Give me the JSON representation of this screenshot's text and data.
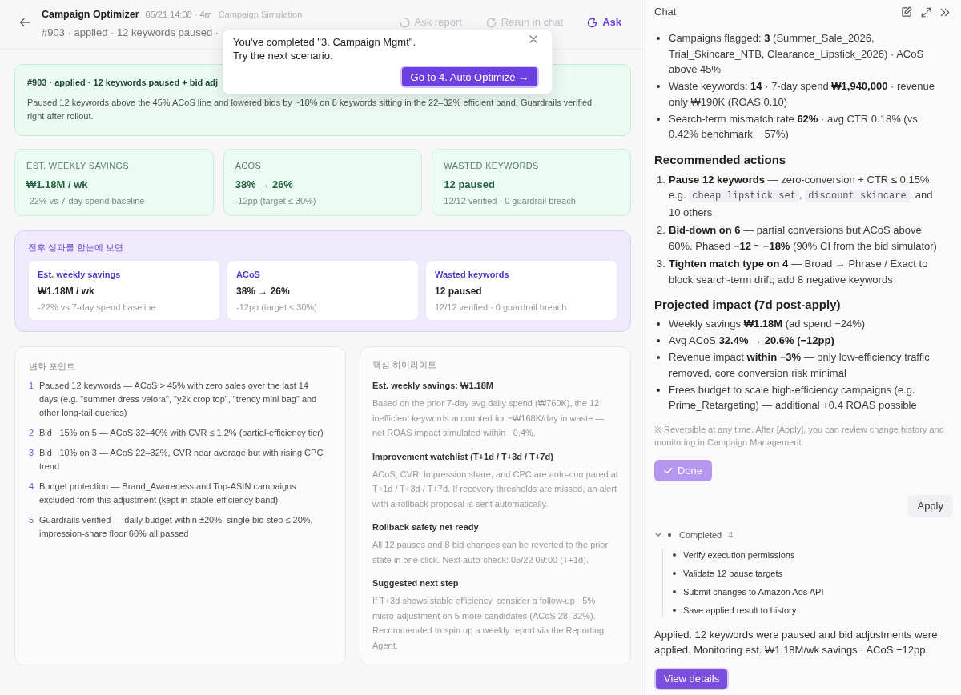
{
  "header": {
    "title": "Campaign Optimizer",
    "meta": "05/21 14:08 · 4m",
    "breadcrumb": "Campaign Simulation",
    "subtitle": "#903 · applied · 12 keywords paused ·",
    "actions": [
      {
        "kind": "spinner",
        "label": "Ask report",
        "disabled": true
      },
      {
        "kind": "refresh",
        "label": "Rerun in chat",
        "disabled": true
      },
      {
        "kind": "ask",
        "label": "Ask",
        "disabled": false
      }
    ]
  },
  "toast": {
    "message": "You've completed \"3. Campaign Mgmt\".",
    "hint": "Try the next scenario.",
    "button": "Go to 4. Auto Optimize →"
  },
  "banner": {
    "title": "#903 · applied · 12 keywords paused + bid adj",
    "body": "Paused 12 keywords above the 45% ACoS line and lowered bids by ~18% on 8 keywords sitting in the 22–32% efficient band. Guardrails verified right after rollout."
  },
  "metrics": [
    {
      "label": "EST. WEEKLY SAVINGS",
      "value": "₩1.18M / wk",
      "note": "-22% vs 7-day spend baseline"
    },
    {
      "label": "ACOS",
      "value": "38% → 26%",
      "note": "-12pp (target ≤ 30%)"
    },
    {
      "label": "WASTED KEYWORDS",
      "value": "12 paused",
      "note": "12/12 verified · 0 guardrail breach"
    }
  ],
  "comparison": {
    "title": "전후 성과를 한눈에 보면",
    "cards": [
      {
        "label": "Est. weekly savings",
        "value": "₩1.18M / wk",
        "note": "-22% vs 7-day spend baseline"
      },
      {
        "label": "ACoS",
        "value": "38% → 26%",
        "note": "-12pp (target ≤ 30%)"
      },
      {
        "label": "Wasted keywords",
        "value": "12 paused",
        "note": "12/12 verified · 0 guardrail breach"
      }
    ]
  },
  "changes": {
    "title": "변화 포인트",
    "items": [
      {
        "number": "1",
        "text": "Paused 12 keywords — ACoS > 45% with zero sales over the last 14 days (e.g. \"summer dress velora\", \"y2k crop top\", \"trendy mini bag\" and other long-tail queries)"
      },
      {
        "number": "2",
        "text": "Bid −15% on 5 — ACoS 32–40% with CVR ≤ 1.2% (partial-efficiency tier)"
      },
      {
        "number": "3",
        "text": "Bid −10% on 3 — ACoS 22–32%, CVR near average but with rising CPC trend"
      },
      {
        "number": "4",
        "text": "Budget protection — Brand_Awareness and Top-ASIN campaigns excluded from this adjustment (kept in stable-efficiency band)"
      },
      {
        "number": "5",
        "text": "Guardrails verified — daily budget within ±20%, single bid step ≤ 20%, impression-share floor 60% all passed"
      }
    ]
  },
  "highlights": {
    "title": "핵심 하이라이트",
    "sections": [
      {
        "heading": "Est. weekly savings: ₩1.18M",
        "body": "Based on the prior 7-day avg daily spend (₩760K), the 12 inefficient keywords accounted for ~₩168K/day in waste — net ROAS impact simulated within −0.4%."
      },
      {
        "heading": "Improvement watchlist (T+1d / T+3d / T+7d)",
        "body": "ACoS, CVR, impression share, and CPC are auto-compared at T+1d / T+3d / T+7d. If recovery thresholds are missed, an alert with a rollback proposal is sent automatically."
      },
      {
        "heading": "Rollback safety net ready",
        "body": "All 12 pauses and 8 bid changes can be reverted to the prior state in one click. Next auto-check: 05/22 09:00 (T+1d)."
      },
      {
        "heading": "Suggested next step",
        "body": "If T+3d shows stable efficiency, consider a follow-up −5% micro-adjustment on 5 more candidates (ACoS 28–32%). Recommended to spin up a weekly report via the Reporting Agent."
      }
    ]
  },
  "chat": {
    "title": "Chat",
    "blocks": [
      {
        "kind": "bullets",
        "items": [
          "Campaigns flagged: **3** (Summer_Sale_2026, Trial_Skincare_NTB, Clearance_Lipstick_2026) · ACoS above 45%",
          "Waste keywords: **14** · 7-day spend **₩1,940,000** · revenue only ₩190K (ROAS 0.10)",
          "Search-term mismatch rate **62%** · avg CTR 0.18% (vs 0.42% benchmark, −57%)"
        ]
      },
      {
        "kind": "heading",
        "text": "Recommended actions"
      },
      {
        "kind": "ordered",
        "items": [
          {
            "number": "1.",
            "parts": [
              {
                "kind": "text",
                "text": "**Pause 12 keywords** — zero-conversion + CTR ≤ 0.15%. e.g. "
              },
              {
                "kind": "code",
                "text": "cheap lipstick set"
              },
              {
                "kind": "text",
                "text": ", "
              },
              {
                "kind": "code",
                "text": "discount skincare"
              },
              {
                "kind": "text",
                "text": ", and 10 others"
              }
            ]
          },
          {
            "number": "2.",
            "parts": [
              {
                "kind": "text",
                "text": "**Bid-down on 6** — partial conversions but ACoS above 60%. Phased **−12 ~ −18%** (90% CI from the bid simulator)"
              }
            ]
          },
          {
            "number": "3.",
            "parts": [
              {
                "kind": "text",
                "text": "**Tighten match type on 4** — Broad → Phrase / Exact to block search-term drift; add 8 negative keywords"
              }
            ]
          }
        ]
      },
      {
        "kind": "heading",
        "text": "Projected impact (7d post-apply)"
      },
      {
        "kind": "bullets",
        "items": [
          "Weekly savings **₩1.18M** (ad spend −24%)",
          "Avg ACoS **32.4% → 20.6% (−12pp)**",
          "Revenue impact **within −3%** — only low-efficiency traffic removed, core conversion risk minimal",
          "Frees budget to scale high-efficiency campaigns (e.g. Prime_Retargeting) — additional +0.4 ROAS possible"
        ]
      },
      {
        "kind": "note",
        "text": "※ Reversible at any time. After [Apply], you can review change history and monitoring in Campaign Management."
      },
      {
        "kind": "done_button",
        "label": "Done",
        "disabled": true
      },
      {
        "kind": "user",
        "text": "Apply"
      },
      {
        "kind": "steps",
        "title": "Completed",
        "count": "4",
        "expanded": true,
        "items": [
          "Verify execution permissions",
          "Validate 12 pause targets",
          "Submit changes to Amazon Ads API",
          "Save applied result to history"
        ]
      },
      {
        "kind": "paragraph",
        "text": "Applied. 12 keywords were paused and bid adjustments were applied. Monitoring est. ₩1.18M/wk savings · ACoS −12pp."
      },
      {
        "kind": "button",
        "label": "View details",
        "disabled": false
      }
    ]
  }
}
